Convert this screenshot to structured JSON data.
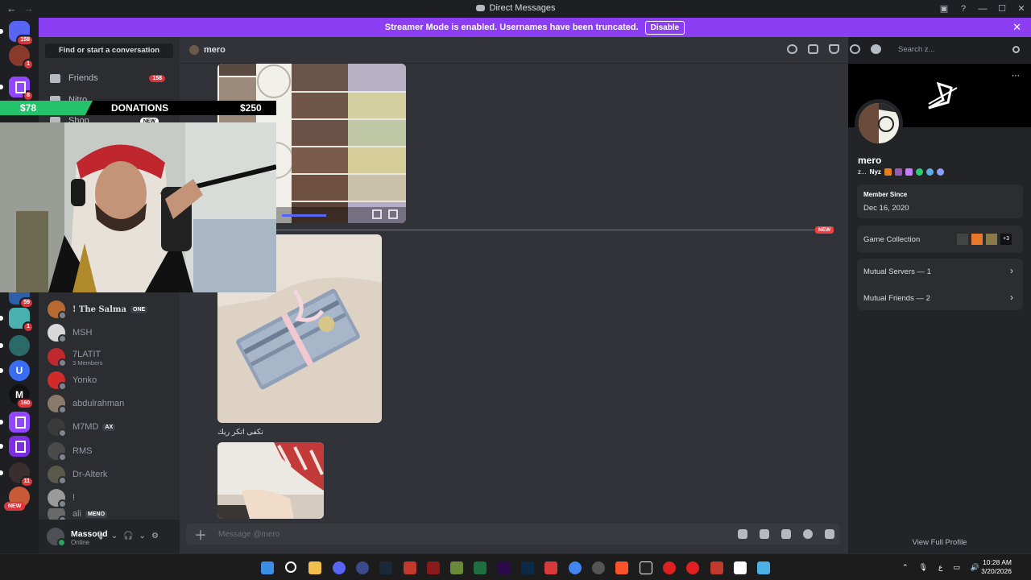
{
  "window": {
    "title": "Direct Messages",
    "nav_back": "←",
    "nav_forward": "→",
    "controls": [
      "—",
      "☐",
      "✕"
    ]
  },
  "streamer_banner": {
    "text": "Streamer Mode is enabled. Usernames have been truncated.",
    "disable_label": "Disable",
    "close": "✕",
    "color": "#8c3ff2"
  },
  "server_rail": {
    "badges": [
      "158",
      "1",
      "8",
      "59",
      "1",
      "160",
      "11"
    ],
    "letters": [
      "U",
      "M"
    ],
    "new_label": "NEW"
  },
  "dm_sidebar": {
    "find_placeholder": "Find or start a conversation",
    "friends_label": "Friends",
    "friends_count": "158",
    "nitro_label": "Nitro",
    "shop_label": "Shop",
    "shop_badge": "NEW",
    "conversations": [
      {
        "name": "! The Salma",
        "tag": "ONE"
      },
      {
        "name": "MSH"
      },
      {
        "name": "7LATIT",
        "sub": "3 Members"
      },
      {
        "name": "Yonko"
      },
      {
        "name": "abdulrahman"
      },
      {
        "name": "M7MD",
        "tag": "AX"
      },
      {
        "name": "RMS"
      },
      {
        "name": "Dr-Alterk"
      },
      {
        "name": "!"
      },
      {
        "name": "ali",
        "tag": "MENO"
      }
    ]
  },
  "user_panel": {
    "name": "Massoud",
    "status": "Online"
  },
  "overlay": {
    "donation_amount": "$78",
    "donation_label": "DONATIONS",
    "donation_goal": "$250",
    "accent": "#23c26b"
  },
  "chat": {
    "recipient": "mero",
    "new_label": "NEW",
    "caption": "تكفى اتكر ريك",
    "composer_placeholder": "Message @mero",
    "search_placeholder": "Search z..."
  },
  "profile": {
    "name": "mero",
    "tag_prefix": "z...",
    "nyz": "Nyz",
    "member_since_label": "Member Since",
    "member_since_value": "Dec 16, 2020",
    "game_collection_label": "Game Collection",
    "game_more": "+3",
    "mutual_servers": "Mutual Servers — 1",
    "mutual_friends": "Mutual Friends — 2",
    "view_full": "View Full Profile"
  },
  "taskbar": {
    "time": "10:28 AM",
    "date": "3/20/2026",
    "lang": "ع"
  }
}
